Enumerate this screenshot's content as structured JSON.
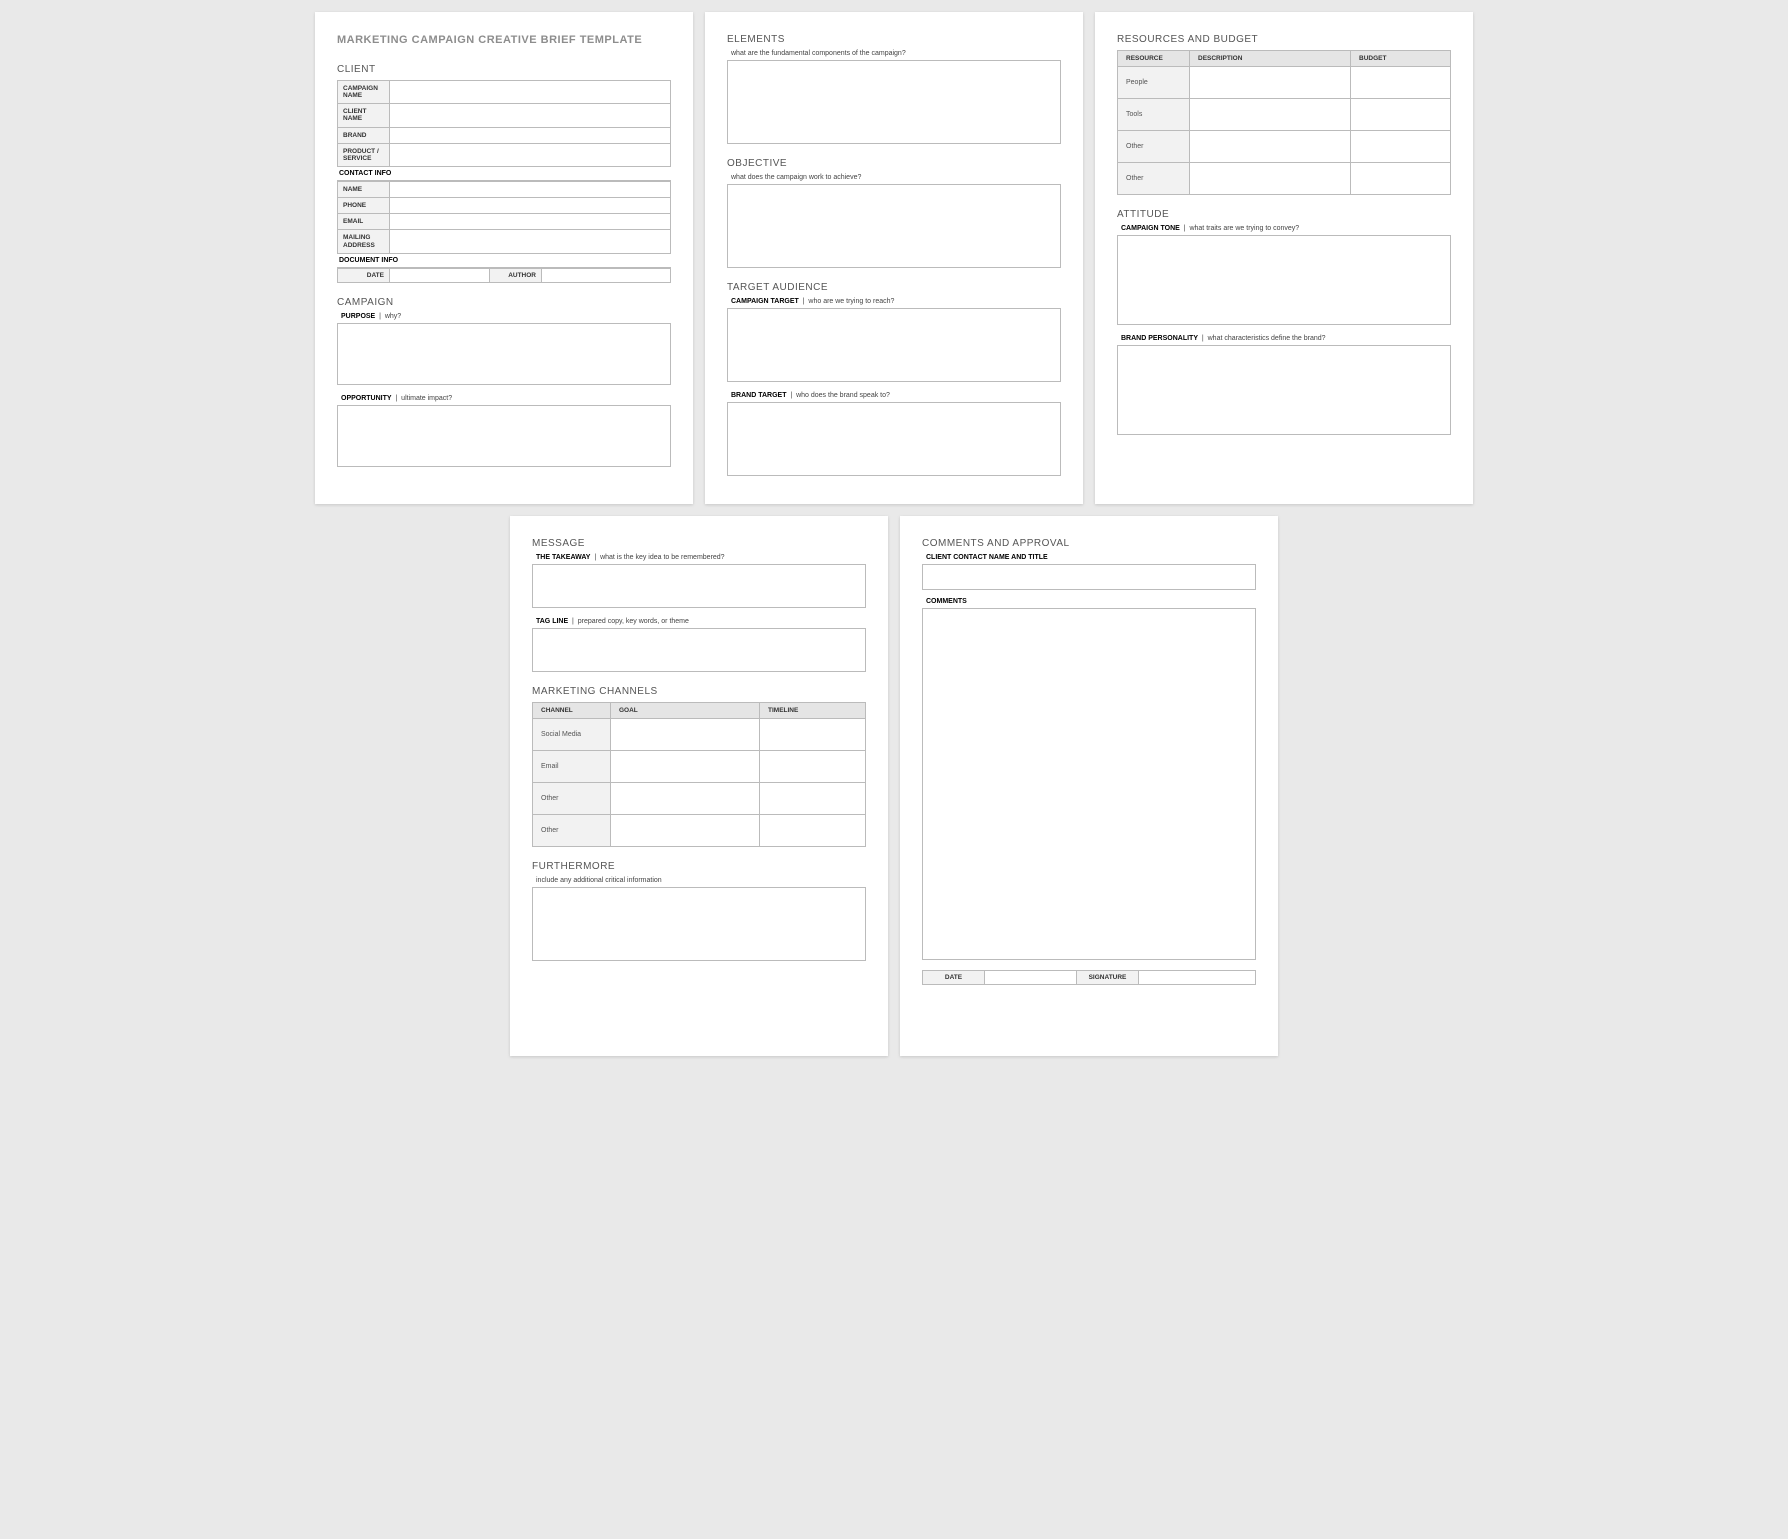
{
  "title": "MARKETING CAMPAIGN CREATIVE BRIEF TEMPLATE",
  "sections": {
    "client": "CLIENT",
    "campaign": "CAMPAIGN",
    "elements": "ELEMENTS",
    "objective": "OBJECTIVE",
    "target_audience": "TARGET AUDIENCE",
    "resources": "RESOURCES AND BUDGET",
    "attitude": "ATTITUDE",
    "message": "MESSAGE",
    "channels": "MARKETING CHANNELS",
    "furthermore": "FURTHERMORE",
    "comments": "COMMENTS AND APPROVAL"
  },
  "client_fields": {
    "campaign_name": "CAMPAIGN NAME",
    "client_name": "CLIENT NAME",
    "brand": "BRAND",
    "product": "PRODUCT / SERVICE",
    "contact_info": "CONTACT INFO",
    "name": "NAME",
    "phone": "PHONE",
    "email": "EMAIL",
    "mailing": "MAILING ADDRESS",
    "doc_info": "DOCUMENT INFO",
    "date": "DATE",
    "author": "AUTHOR"
  },
  "campaign_fields": {
    "purpose_label": "PURPOSE",
    "purpose_hint": "why?",
    "opportunity_label": "OPPORTUNITY",
    "opportunity_hint": "ultimate impact?"
  },
  "elements_hint": "what are the fundamental components of the campaign?",
  "objective_hint": "what does the campaign work to achieve?",
  "audience": {
    "campaign_target_label": "CAMPAIGN TARGET",
    "campaign_target_hint": "who are we trying to reach?",
    "brand_target_label": "BRAND TARGET",
    "brand_target_hint": "who does the brand speak to?"
  },
  "resources_table": {
    "headers": {
      "resource": "RESOURCE",
      "description": "DESCRIPTION",
      "budget": "BUDGET"
    },
    "rows": [
      "People",
      "Tools",
      "Other",
      "Other"
    ]
  },
  "attitude": {
    "tone_label": "CAMPAIGN TONE",
    "tone_hint": "what traits are we trying to convey?",
    "personality_label": "BRAND PERSONALITY",
    "personality_hint": "what characteristics define the brand?"
  },
  "message": {
    "takeaway_label": "THE TAKEAWAY",
    "takeaway_hint": "what is the key idea to be remembered?",
    "tagline_label": "TAG LINE",
    "tagline_hint": "prepared copy, key words, or theme"
  },
  "channels_table": {
    "headers": {
      "channel": "CHANNEL",
      "goal": "GOAL",
      "timeline": "TIMELINE"
    },
    "rows": [
      "Social Media",
      "Email",
      "Other",
      "Other"
    ]
  },
  "furthermore_hint": "include any additional critical information",
  "comments": {
    "contact_label": "CLIENT CONTACT NAME AND TITLE",
    "comments_label": "COMMENTS",
    "date": "DATE",
    "signature": "SIGNATURE"
  }
}
